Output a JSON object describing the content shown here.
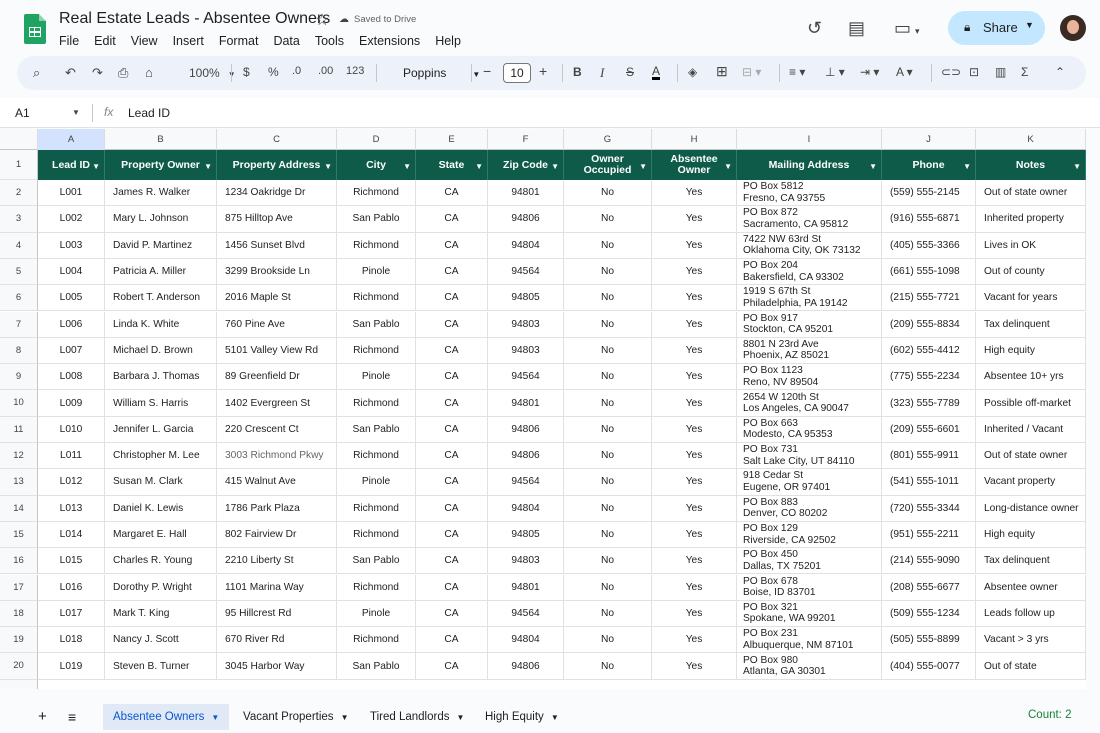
{
  "doc": {
    "title": "Real Estate Leads - Absentee Owners",
    "saved": "Saved to Drive"
  },
  "menu": [
    "File",
    "Edit",
    "View",
    "Insert",
    "Format",
    "Data",
    "Tools",
    "Extensions",
    "Help"
  ],
  "share_label": "Share",
  "toolbar": {
    "zoom": "100%",
    "currency": "$",
    "percent": "%",
    "dec_dec": ".0",
    "inc_dec": ".00",
    "numfmt": "123",
    "font": "Poppins",
    "font_size": "10"
  },
  "formula": {
    "name_box": "A1",
    "fx": "fx",
    "value": "Lead ID"
  },
  "columns": [
    "A",
    "B",
    "C",
    "D",
    "E",
    "F",
    "G",
    "H",
    "I",
    "J",
    "K"
  ],
  "headers": [
    "Lead ID",
    "Property Owner",
    "Property Address",
    "City",
    "State",
    "Zip Code",
    "Owner Occupied",
    "Absentee Owner",
    "Mailing Address",
    "Phone",
    "Notes"
  ],
  "rows": [
    {
      "n": "2",
      "id": "L001",
      "owner": "James R. Walker",
      "addr": "1234 Oakridge Dr",
      "city": "Richmond",
      "state": "CA",
      "zip": "94801",
      "occ": "No",
      "abs": "Yes",
      "m1": "PO Box 5812",
      "m2": "Fresno, CA 93755",
      "phone": "(559) 555-2145",
      "notes": "Out of state owner"
    },
    {
      "n": "3",
      "id": "L002",
      "owner": "Mary L. Johnson",
      "addr": "875 Hilltop Ave",
      "city": "San Pablo",
      "state": "CA",
      "zip": "94806",
      "occ": "No",
      "abs": "Yes",
      "m1": "PO Box 872",
      "m2": "Sacramento, CA 95812",
      "phone": "(916) 555-6871",
      "notes": "Inherited property"
    },
    {
      "n": "4",
      "id": "L003",
      "owner": "David P. Martinez",
      "addr": "1456 Sunset Blvd",
      "city": "Richmond",
      "state": "CA",
      "zip": "94804",
      "occ": "No",
      "abs": "Yes",
      "m1": "7422 NW 63rd St",
      "m2": "Oklahoma City, OK 73132",
      "phone": "(405) 555-3366",
      "notes": "Lives in OK"
    },
    {
      "n": "5",
      "id": "L004",
      "owner": "Patricia A. Miller",
      "addr": "3299 Brookside Ln",
      "city": "Pinole",
      "state": "CA",
      "zip": "94564",
      "occ": "No",
      "abs": "Yes",
      "m1": "PO Box 204",
      "m2": "Bakersfield, CA 93302",
      "phone": "(661) 555-1098",
      "notes": "Out of county"
    },
    {
      "n": "6",
      "id": "L005",
      "owner": "Robert T. Anderson",
      "addr": "2016 Maple St",
      "city": "Richmond",
      "state": "CA",
      "zip": "94805",
      "occ": "No",
      "abs": "Yes",
      "m1": "1919 S 67th St",
      "m2": "Philadelphia, PA 19142",
      "phone": "(215) 555-7721",
      "notes": "Vacant for years"
    },
    {
      "n": "7",
      "id": "L006",
      "owner": "Linda K. White",
      "addr": "760 Pine Ave",
      "city": "San Pablo",
      "state": "CA",
      "zip": "94803",
      "occ": "No",
      "abs": "Yes",
      "m1": "PO Box 917",
      "m2": "Stockton, CA 95201",
      "phone": "(209) 555-8834",
      "notes": "Tax delinquent"
    },
    {
      "n": "8",
      "id": "L007",
      "owner": "Michael D. Brown",
      "addr": "5101 Valley View Rd",
      "city": "Richmond",
      "state": "CA",
      "zip": "94803",
      "occ": "No",
      "abs": "Yes",
      "m1": "8801 N 23rd Ave",
      "m2": "Phoenix, AZ 85021",
      "phone": "(602) 555-4412",
      "notes": "High equity"
    },
    {
      "n": "9",
      "id": "L008",
      "owner": "Barbara J. Thomas",
      "addr": "89 Greenfield Dr",
      "city": "Pinole",
      "state": "CA",
      "zip": "94564",
      "occ": "No",
      "abs": "Yes",
      "m1": "PO Box 1123",
      "m2": "Reno, NV 89504",
      "phone": "(775) 555-2234",
      "notes": "Absentee 10+ yrs"
    },
    {
      "n": "10",
      "id": "L009",
      "owner": "William S. Harris",
      "addr": "1402 Evergreen St",
      "city": "Richmond",
      "state": "CA",
      "zip": "94801",
      "occ": "No",
      "abs": "Yes",
      "m1": "2654 W 120th St",
      "m2": "Los Angeles, CA 90047",
      "phone": "(323) 555-7789",
      "notes": "Possible off-market"
    },
    {
      "n": "11",
      "id": "L010",
      "owner": "Jennifer L. Garcia",
      "addr": "220 Crescent Ct",
      "city": "San Pablo",
      "state": "CA",
      "zip": "94806",
      "occ": "No",
      "abs": "Yes",
      "m1": "PO Box 663",
      "m2": "Modesto, CA 95353",
      "phone": "(209) 555-6601",
      "notes": "Inherited / Vacant"
    },
    {
      "n": "12",
      "id": "L011",
      "owner": "Christopher M. Lee",
      "addr": "3003 Richmond Pkwy",
      "city": "Richmond",
      "state": "CA",
      "zip": "94806",
      "occ": "No",
      "abs": "Yes",
      "m1": "PO Box 731",
      "m2": "Salt Lake City, UT 84110",
      "phone": "(801) 555-9911",
      "notes": "Out of state owner"
    },
    {
      "n": "13",
      "id": "L012",
      "owner": "Susan M. Clark",
      "addr": "415 Walnut Ave",
      "city": "Pinole",
      "state": "CA",
      "zip": "94564",
      "occ": "No",
      "abs": "Yes",
      "m1": "918 Cedar St",
      "m2": "Eugene, OR 97401",
      "phone": "(541) 555-1011",
      "notes": "Vacant property"
    },
    {
      "n": "14",
      "id": "L013",
      "owner": "Daniel K. Lewis",
      "addr": "1786 Park Plaza",
      "city": "Richmond",
      "state": "CA",
      "zip": "94804",
      "occ": "No",
      "abs": "Yes",
      "m1": "PO Box 883",
      "m2": "Denver, CO 80202",
      "phone": "(720) 555-3344",
      "notes": "Long-distance owner"
    },
    {
      "n": "15",
      "id": "L014",
      "owner": "Margaret E. Hall",
      "addr": "802 Fairview Dr",
      "city": "Richmond",
      "state": "CA",
      "zip": "94805",
      "occ": "No",
      "abs": "Yes",
      "m1": "PO Box 129",
      "m2": "Riverside, CA 92502",
      "phone": "(951) 555-2211",
      "notes": "High equity"
    },
    {
      "n": "16",
      "id": "L015",
      "owner": "Charles R. Young",
      "addr": "2210 Liberty St",
      "city": "San Pablo",
      "state": "CA",
      "zip": "94803",
      "occ": "No",
      "abs": "Yes",
      "m1": "PO Box 450",
      "m2": "Dallas, TX 75201",
      "phone": "(214) 555-9090",
      "notes": "Tax delinquent"
    },
    {
      "n": "17",
      "id": "L016",
      "owner": "Dorothy P. Wright",
      "addr": "1101 Marina Way",
      "city": "Richmond",
      "state": "CA",
      "zip": "94801",
      "occ": "No",
      "abs": "Yes",
      "m1": "PO Box 678",
      "m2": "Boise, ID 83701",
      "phone": "(208) 555-6677",
      "notes": "Absentee owner"
    },
    {
      "n": "18",
      "id": "L017",
      "owner": "Mark T. King",
      "addr": "95 Hillcrest Rd",
      "city": "Pinole",
      "state": "CA",
      "zip": "94564",
      "occ": "No",
      "abs": "Yes",
      "m1": "PO Box 321",
      "m2": "Spokane, WA 99201",
      "phone": "(509) 555-1234",
      "notes": "Leads follow up"
    },
    {
      "n": "19",
      "id": "L018",
      "owner": "Nancy J. Scott",
      "addr": "670 River Rd",
      "city": "Richmond",
      "state": "CA",
      "zip": "94804",
      "occ": "No",
      "abs": "Yes",
      "m1": "PO Box 231",
      "m2": "Albuquerque, NM 87101",
      "phone": "(505) 555-8899",
      "notes": "Vacant > 3 yrs"
    },
    {
      "n": "20",
      "id": "L019",
      "owner": "Steven B. Turner",
      "addr": "3045 Harbor Way",
      "city": "San Pablo",
      "state": "CA",
      "zip": "94806",
      "occ": "No",
      "abs": "Yes",
      "m1": "PO Box 980",
      "m2": "Atlanta, GA 30301",
      "phone": "(404) 555-0077",
      "notes": "Out of state"
    }
  ],
  "sheets": [
    "Absentee Owners",
    "Vacant Properties",
    "Tired Landlords",
    "High Equity"
  ],
  "status": {
    "count": "Count: 2"
  },
  "colors": {
    "header_bg": "#0d5b48",
    "share_bg": "#c2e7ff",
    "active_tab": "#0b57d0"
  }
}
